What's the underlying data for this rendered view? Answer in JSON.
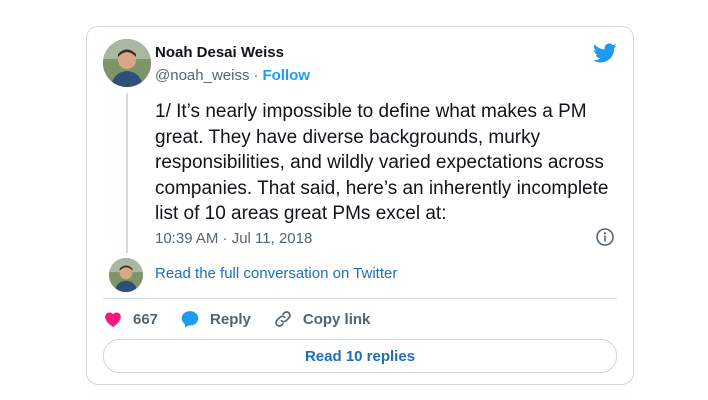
{
  "author": {
    "name": "Noah Desai Weiss",
    "handle": "@noah_weiss",
    "separator": "·",
    "follow_label": "Follow"
  },
  "tweet": {
    "text": "1/ It’s nearly impossible to define what makes a PM great. They have diverse backgrounds, murky responsibilities, and wildly varied expectations across companies. That said, here’s an inherently incomplete list of 10 areas great PMs excel at:",
    "timestamp": "10:39 AM · Jul 11, 2018"
  },
  "conversation": {
    "link_label": "Read the full conversation on Twitter"
  },
  "actions": {
    "like_count": "667",
    "reply_label": "Reply",
    "copy_label": "Copy link"
  },
  "replies_button": {
    "label": "Read 10 replies"
  },
  "colors": {
    "brand": "#1d9bf0",
    "link": "#1d6fb8",
    "like": "#f91880",
    "muted": "#536471",
    "border": "#cfd9de"
  },
  "icons": [
    "twitter-bird-icon",
    "info-icon",
    "heart-icon",
    "reply-bubble-icon",
    "link-icon"
  ]
}
